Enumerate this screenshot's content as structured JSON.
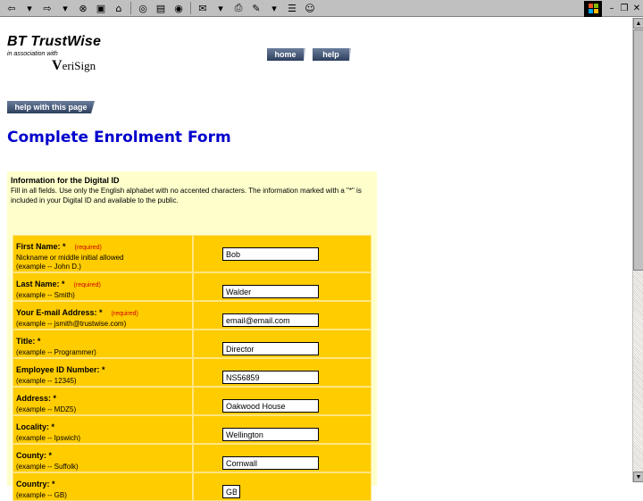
{
  "brand": {
    "name": "BT TrustWise",
    "association": "in association with",
    "partner_prefix": "V",
    "partner_rest": "eriSign"
  },
  "nav": {
    "home_label": "home",
    "help_label": "help",
    "help_page_label": "help with this page"
  },
  "page_title": "Complete Enrolment Form",
  "info": {
    "title": "Information for the Digital ID",
    "text": "Fill in all fields. Use only the English alphabet with no accented characters. The information marked with a \"*\" is included in your Digital ID and available to the public."
  },
  "fields": [
    {
      "label": "First Name: *",
      "required": "(required)",
      "example": "Nickname or middle initial allowed",
      "example2": "(example -- John D.)",
      "value": "Bob"
    },
    {
      "label": "Last Name: *",
      "required": "(required)",
      "example": "(example -- Smith)",
      "example2": "",
      "value": "Walder"
    },
    {
      "label": "Your E-mail Address: *",
      "required": "(required)",
      "example": "(example -- jsmith@trustwise.com)",
      "example2": "",
      "value": "email@email.com"
    },
    {
      "label": "Title: *",
      "required": "",
      "example": "(example -- Programmer)",
      "example2": "",
      "value": "Director"
    },
    {
      "label": "Employee ID Number: *",
      "required": "",
      "example": "(example -- 12345)",
      "example2": "",
      "value": "NS56859"
    },
    {
      "label": "Address: *",
      "required": "",
      "example": "(example -- MDZ5)",
      "example2": "",
      "value": "Oakwood House"
    },
    {
      "label": "Locality: *",
      "required": "",
      "example": "(example -- Ipswich)",
      "example2": "",
      "value": "Wellington"
    },
    {
      "label": "County: *",
      "required": "",
      "example": "(example -- Suffolk)",
      "example2": "",
      "value": "Cornwall"
    },
    {
      "label": "Country: *",
      "required": "",
      "example": "(example -- GB)",
      "example2": "",
      "value": "GB"
    }
  ]
}
